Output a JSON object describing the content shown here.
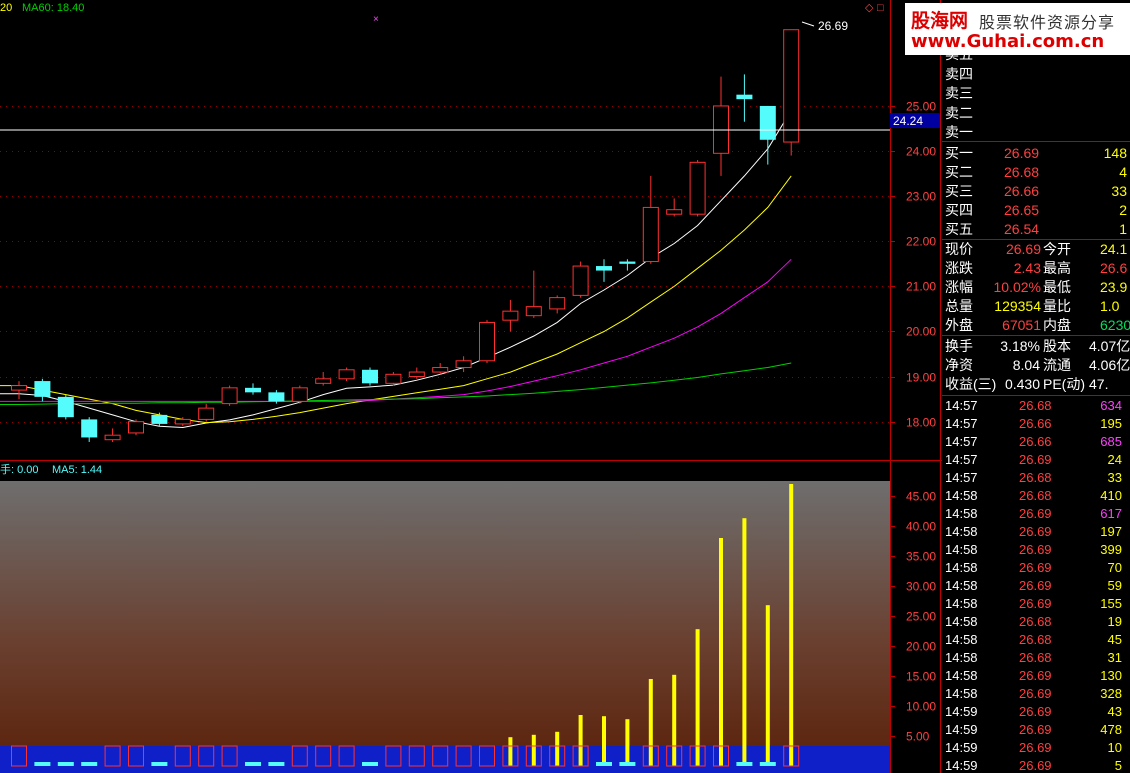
{
  "header": {
    "left_fragment": "20",
    "ma60_label": "MA60: 18.40",
    "vol_fragment": "手: 0.00",
    "vol_ma5": "MA5: 1.44"
  },
  "price_labels": {
    "high_marker": "26.69",
    "current_line": "24.24"
  },
  "watermark": {
    "brand": "股海网",
    "slogan": "股票软件资源分享",
    "url": "www.Guhai.com.cn"
  },
  "chart_data": {
    "type": "candlestick",
    "price_axis": {
      "ticks": [
        "25.00",
        "24.00",
        "23.00",
        "22.00",
        "21.00",
        "20.00",
        "19.00",
        "18.00"
      ],
      "range": [
        17.15,
        26.95
      ]
    },
    "volume_axis": {
      "ticks": [
        "45.00",
        "40.00",
        "35.00",
        "30.00",
        "25.00",
        "20.00",
        "15.00",
        "10.00",
        "5.00"
      ],
      "range": [
        0,
        47.5
      ]
    },
    "candles": [
      {
        "o": 18.7,
        "c": 18.8,
        "h": 18.9,
        "l": 18.5
      },
      {
        "o": 18.9,
        "c": 18.55,
        "h": 18.95,
        "l": 18.45
      },
      {
        "o": 18.55,
        "c": 18.1,
        "h": 18.6,
        "l": 18.05
      },
      {
        "o": 18.05,
        "c": 17.65,
        "h": 18.1,
        "l": 17.55
      },
      {
        "o": 17.6,
        "c": 17.7,
        "h": 17.85,
        "l": 17.55
      },
      {
        "o": 17.75,
        "c": 18.0,
        "h": 18.05,
        "l": 17.7
      },
      {
        "o": 18.15,
        "c": 17.95,
        "h": 18.2,
        "l": 17.9
      },
      {
        "o": 17.95,
        "c": 18.05,
        "h": 18.1,
        "l": 17.9
      },
      {
        "o": 18.05,
        "c": 18.3,
        "h": 18.4,
        "l": 18.0
      },
      {
        "o": 18.4,
        "c": 18.75,
        "h": 18.8,
        "l": 18.35
      },
      {
        "o": 18.75,
        "c": 18.65,
        "h": 18.85,
        "l": 18.6
      },
      {
        "o": 18.65,
        "c": 18.45,
        "h": 18.7,
        "l": 18.4
      },
      {
        "o": 18.45,
        "c": 18.75,
        "h": 18.8,
        "l": 18.4
      },
      {
        "o": 18.85,
        "c": 18.95,
        "h": 19.1,
        "l": 18.8
      },
      {
        "o": 18.95,
        "c": 19.15,
        "h": 19.2,
        "l": 18.9
      },
      {
        "o": 19.15,
        "c": 18.85,
        "h": 19.2,
        "l": 18.8
      },
      {
        "o": 18.85,
        "c": 19.05,
        "h": 19.1,
        "l": 18.8
      },
      {
        "o": 19.0,
        "c": 19.1,
        "h": 19.2,
        "l": 18.95
      },
      {
        "o": 19.1,
        "c": 19.2,
        "h": 19.3,
        "l": 19.05
      },
      {
        "o": 19.2,
        "c": 19.35,
        "h": 19.45,
        "l": 19.1
      },
      {
        "o": 19.35,
        "c": 20.2,
        "h": 20.25,
        "l": 19.3
      },
      {
        "o": 20.25,
        "c": 20.45,
        "h": 20.7,
        "l": 20.0
      },
      {
        "o": 20.35,
        "c": 20.55,
        "h": 21.35,
        "l": 20.3
      },
      {
        "o": 20.5,
        "c": 20.75,
        "h": 20.8,
        "l": 20.4
      },
      {
        "o": 20.8,
        "c": 21.45,
        "h": 21.55,
        "l": 20.75
      },
      {
        "o": 21.45,
        "c": 21.35,
        "h": 21.6,
        "l": 21.1
      },
      {
        "o": 21.55,
        "c": 21.5,
        "h": 21.6,
        "l": 21.35
      },
      {
        "o": 21.55,
        "c": 22.75,
        "h": 23.45,
        "l": 21.5
      },
      {
        "o": 22.6,
        "c": 22.7,
        "h": 22.95,
        "l": 22.55
      },
      {
        "o": 22.6,
        "c": 23.75,
        "h": 23.8,
        "l": 22.55
      },
      {
        "o": 23.95,
        "c": 25.0,
        "h": 25.65,
        "l": 23.45
      },
      {
        "o": 25.25,
        "c": 25.15,
        "h": 25.7,
        "l": 24.65
      },
      {
        "o": 25.0,
        "c": 24.25,
        "h": 25.0,
        "l": 23.7
      },
      {
        "o": 24.2,
        "c": 26.69,
        "h": 26.69,
        "l": 23.9
      }
    ],
    "volume": [
      0.6,
      0.5,
      0.5,
      0.4,
      0.4,
      0.4,
      0.4,
      0.4,
      0.5,
      0.4,
      0.5,
      0.5,
      0.6,
      0.6,
      0.5,
      0.6,
      0.6,
      0.6,
      1.0,
      1.2,
      3.0,
      4.8,
      5.2,
      5.7,
      8.5,
      8.3,
      7.8,
      14.5,
      15.2,
      22.8,
      38.0,
      41.3,
      26.8,
      47.0
    ],
    "moving_averages": [
      {
        "label": "MA5",
        "color": "#ffffff",
        "values": [
          18.62,
          18.58,
          18.45,
          18.3,
          18.15,
          18.0,
          17.9,
          17.87,
          17.97,
          18.04,
          18.15,
          18.29,
          18.43,
          18.6,
          18.74,
          18.77,
          18.81,
          18.92,
          19.05,
          19.2,
          19.42,
          19.65,
          19.9,
          20.2,
          20.62,
          20.92,
          21.24,
          21.63,
          21.95,
          22.35,
          22.9,
          23.45,
          24.05,
          24.9
        ]
      },
      {
        "label": "MA10",
        "color": "#ffff00",
        "values": [
          18.8,
          18.7,
          18.6,
          18.5,
          18.4,
          18.25,
          18.15,
          18.05,
          17.98,
          18.0,
          18.05,
          18.12,
          18.2,
          18.3,
          18.4,
          18.48,
          18.56,
          18.64,
          18.72,
          18.8,
          18.95,
          19.1,
          19.3,
          19.5,
          19.75,
          20.0,
          20.3,
          20.65,
          21.0,
          21.4,
          21.8,
          22.25,
          22.75,
          23.45
        ]
      },
      {
        "label": "MA20",
        "color": "#ff00ff",
        "values": [
          18.45,
          18.45,
          18.45,
          18.45,
          18.45,
          18.45,
          18.45,
          18.45,
          18.45,
          18.45,
          18.45,
          18.45,
          18.45,
          18.45,
          18.45,
          18.47,
          18.5,
          18.53,
          18.56,
          18.6,
          18.68,
          18.78,
          18.9,
          19.02,
          19.15,
          19.3,
          19.45,
          19.65,
          19.85,
          20.1,
          20.4,
          20.75,
          21.1,
          21.6
        ]
      },
      {
        "label": "MA60",
        "color": "#00d000",
        "values": [
          18.38,
          18.39,
          18.4,
          18.4,
          18.41,
          18.41,
          18.42,
          18.42,
          18.43,
          18.43,
          18.44,
          18.45,
          18.46,
          18.47,
          18.48,
          18.49,
          18.5,
          18.51,
          18.53,
          18.55,
          18.57,
          18.6,
          18.63,
          18.67,
          18.71,
          18.76,
          18.81,
          18.86,
          18.92,
          18.98,
          19.06,
          19.13,
          19.2,
          19.3
        ]
      }
    ]
  },
  "orderbook": {
    "sell": [
      {
        "label": "卖五",
        "price": "",
        "vol": ""
      },
      {
        "label": "卖四",
        "price": "",
        "vol": ""
      },
      {
        "label": "卖三",
        "price": "",
        "vol": ""
      },
      {
        "label": "卖二",
        "price": "",
        "vol": ""
      },
      {
        "label": "卖一",
        "price": "",
        "vol": ""
      }
    ],
    "buy": [
      {
        "label": "买一",
        "price": "26.69",
        "vol": "148"
      },
      {
        "label": "买二",
        "price": "26.68",
        "vol": "4"
      },
      {
        "label": "买三",
        "price": "26.66",
        "vol": "33"
      },
      {
        "label": "买四",
        "price": "26.65",
        "vol": "2"
      },
      {
        "label": "买五",
        "price": "26.54",
        "vol": "1"
      }
    ]
  },
  "stats": [
    [
      {
        "label": "现价",
        "value": "26.69",
        "color": "#ff4040"
      },
      {
        "label": "今开",
        "value": "24.1",
        "color": "#ffff00"
      }
    ],
    [
      {
        "label": "涨跌",
        "value": "2.43",
        "color": "#ff4040"
      },
      {
        "label": "最高",
        "value": "26.6",
        "color": "#ff4040"
      }
    ],
    [
      {
        "label": "涨幅",
        "value": "10.02%",
        "color": "#ff4040"
      },
      {
        "label": "最低",
        "value": "23.9",
        "color": "#ffff00"
      }
    ],
    [
      {
        "label": "总量",
        "value": "129354",
        "color": "#ffff00"
      },
      {
        "label": "量比",
        "value": "1.0",
        "color": "#ffff00"
      }
    ],
    [
      {
        "label": "外盘",
        "value": "67051",
        "color": "#ff4040"
      },
      {
        "label": "内盘",
        "value": "6230",
        "color": "#00e060"
      }
    ]
  ],
  "fundamentals": [
    [
      {
        "label": "换手",
        "value": "3.18%"
      },
      {
        "label": "股本",
        "value": "4.07亿"
      }
    ],
    [
      {
        "label": "净资",
        "value": "8.04"
      },
      {
        "label": "流通",
        "value": "4.06亿"
      }
    ],
    [
      {
        "label": "收益(三)",
        "value": "0.430"
      },
      {
        "label": "PE(动)",
        "value": "47."
      }
    ]
  ],
  "ticks": [
    {
      "time": "14:57",
      "price": "26.68",
      "vol": "634",
      "vcolor": "#ff40ff"
    },
    {
      "time": "14:57",
      "price": "26.66",
      "vol": "195",
      "vcolor": "#ffff00"
    },
    {
      "time": "14:57",
      "price": "26.66",
      "vol": "685",
      "vcolor": "#ff40ff"
    },
    {
      "time": "14:57",
      "price": "26.69",
      "vol": "24",
      "vcolor": "#ffff00"
    },
    {
      "time": "14:57",
      "price": "26.68",
      "vol": "33",
      "vcolor": "#ffff00"
    },
    {
      "time": "14:58",
      "price": "26.68",
      "vol": "410",
      "vcolor": "#ffff00"
    },
    {
      "time": "14:58",
      "price": "26.69",
      "vol": "617",
      "vcolor": "#ff40ff"
    },
    {
      "time": "14:58",
      "price": "26.69",
      "vol": "197",
      "vcolor": "#ffff00"
    },
    {
      "time": "14:58",
      "price": "26.69",
      "vol": "399",
      "vcolor": "#ffff00"
    },
    {
      "time": "14:58",
      "price": "26.69",
      "vol": "70",
      "vcolor": "#ffff00"
    },
    {
      "time": "14:58",
      "price": "26.69",
      "vol": "59",
      "vcolor": "#ffff00"
    },
    {
      "time": "14:58",
      "price": "26.69",
      "vol": "155",
      "vcolor": "#ffff00"
    },
    {
      "time": "14:58",
      "price": "26.68",
      "vol": "19",
      "vcolor": "#ffff00"
    },
    {
      "time": "14:58",
      "price": "26.68",
      "vol": "45",
      "vcolor": "#ffff00"
    },
    {
      "time": "14:58",
      "price": "26.68",
      "vol": "31",
      "vcolor": "#ffff00"
    },
    {
      "time": "14:58",
      "price": "26.69",
      "vol": "130",
      "vcolor": "#ffff00"
    },
    {
      "time": "14:58",
      "price": "26.69",
      "vol": "328",
      "vcolor": "#ffff00"
    },
    {
      "time": "14:59",
      "price": "26.69",
      "vol": "43",
      "vcolor": "#ffff00"
    },
    {
      "time": "14:59",
      "price": "26.69",
      "vol": "478",
      "vcolor": "#ffff00"
    },
    {
      "time": "14:59",
      "price": "26.69",
      "vol": "10",
      "vcolor": "#ffff00"
    },
    {
      "time": "14:59",
      "price": "26.69",
      "vol": "5",
      "vcolor": "#ffff00"
    }
  ],
  "colors": {
    "up": "#ff3030",
    "down": "#54fcfc",
    "volume_bar": "#ffff00",
    "border": "#c00000"
  }
}
